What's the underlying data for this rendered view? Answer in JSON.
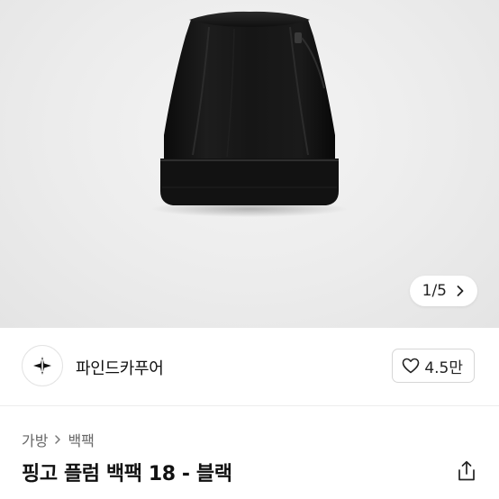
{
  "gallery": {
    "indicator": "1/5",
    "image_alt_name": "black-bucket-backpack"
  },
  "shop": {
    "name": "파인드카푸어",
    "likes": "4.5만"
  },
  "breadcrumb": {
    "items": [
      "가방",
      "백팩"
    ]
  },
  "product": {
    "title": "핑고 플럼 백팩 18 - 블랙"
  },
  "icons": {
    "shop_logo": "sparkle-logo-icon",
    "like": "heart-icon",
    "share": "share-icon",
    "next": "chevron-right-icon",
    "breadcrumb_sep": "chevron-right-icon"
  },
  "colors": {
    "product": "#111111",
    "gallery_bg": "#ececec"
  }
}
